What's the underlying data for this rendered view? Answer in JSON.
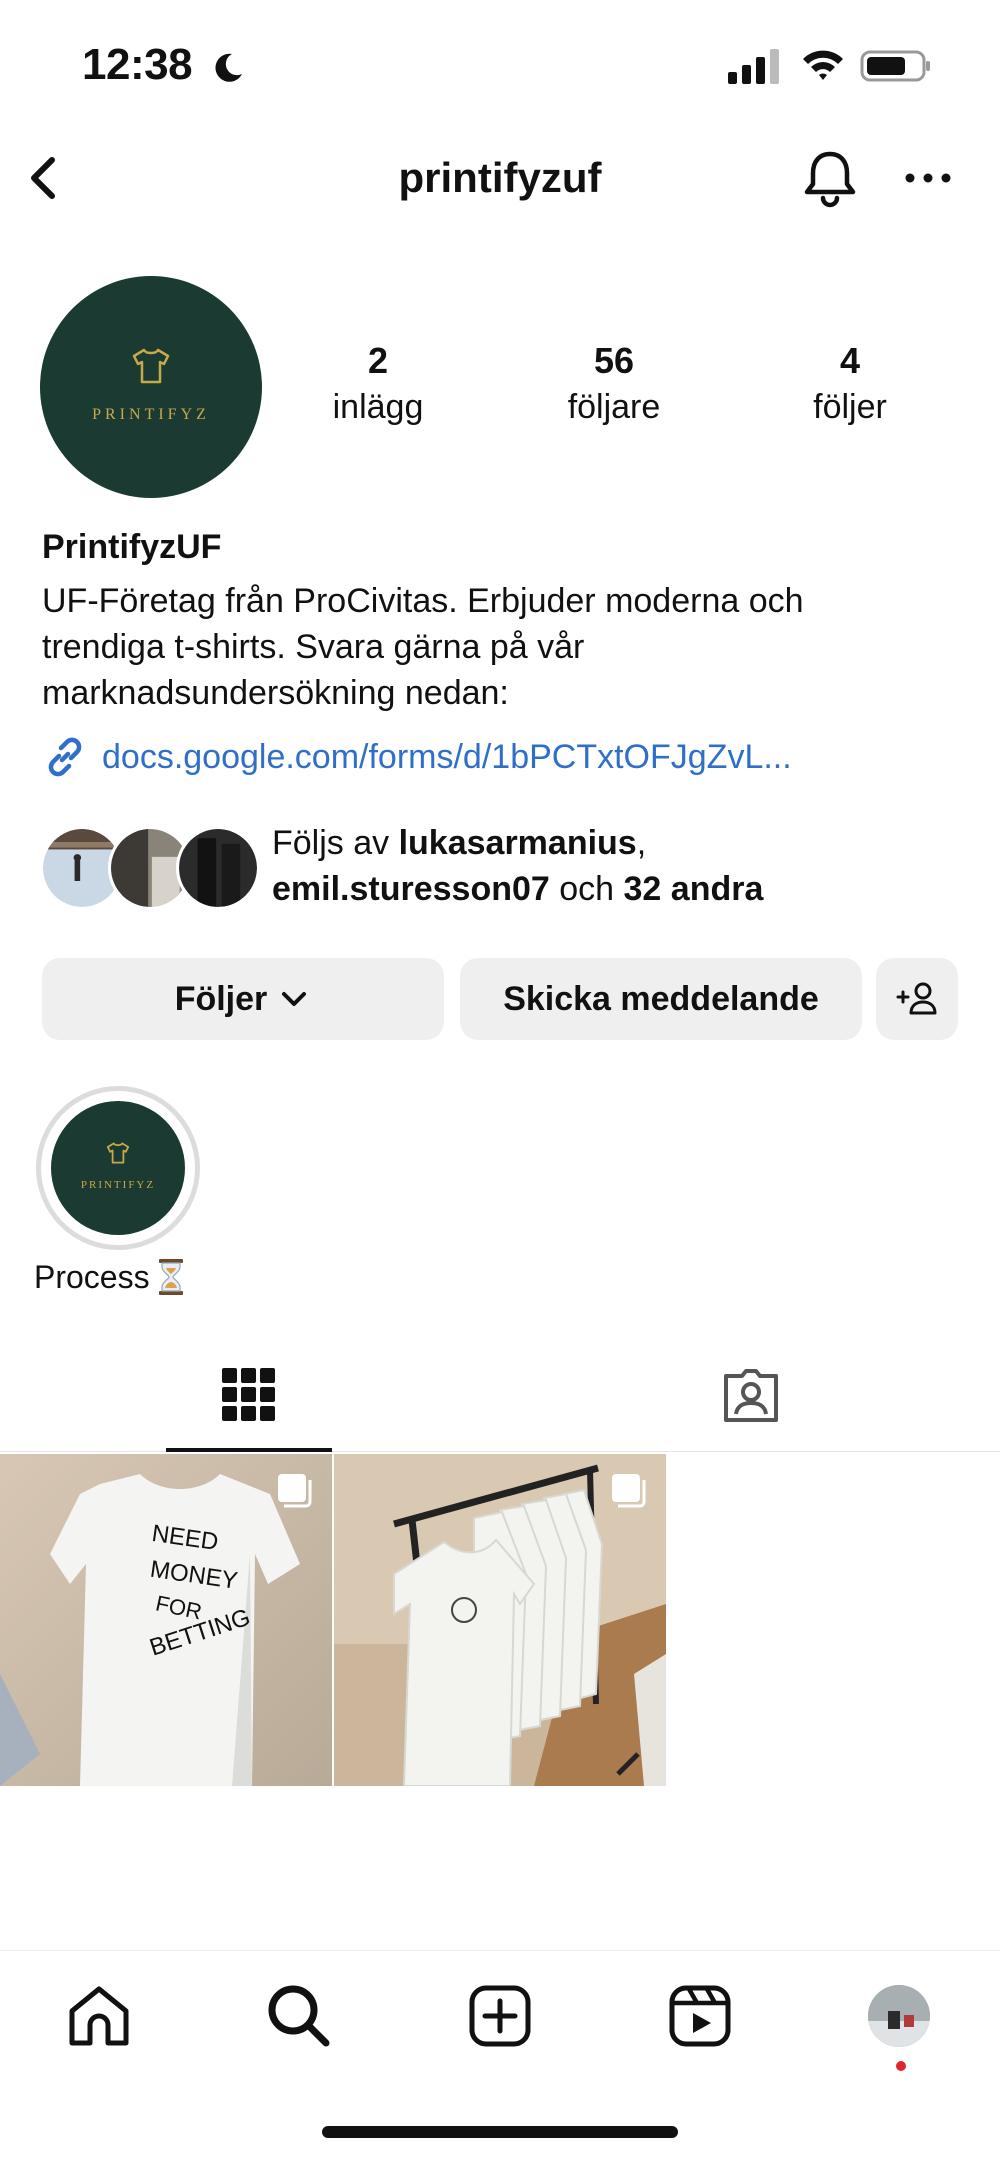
{
  "status_bar": {
    "time": "12:38"
  },
  "header": {
    "title": "printifyzuf"
  },
  "profile": {
    "avatar_brand": "PRINTIFYZ",
    "stats": [
      {
        "value": "2",
        "label": "inlägg"
      },
      {
        "value": "56",
        "label": "följare"
      },
      {
        "value": "4",
        "label": "följer"
      }
    ],
    "name": "PrintifyzUF",
    "bio_lines": [
      "UF-Företag från ProCivitas. Erbjuder moderna och",
      "trendiga t-shirts. Svara gärna på vår",
      "marknadsundersökning nedan:"
    ],
    "link": "docs.google.com/forms/d/1bPCTxtOFJgZvL..."
  },
  "followed_by": {
    "prefix": "Följs av ",
    "user1": "lukasarmanius",
    "comma": ",",
    "user2": "emil.sturesson07",
    "conjunction": " och ",
    "others": "32 andra"
  },
  "buttons": {
    "follow_label": "Följer",
    "message_label": "Skicka meddelande"
  },
  "highlights": [
    {
      "label": "Process",
      "brand": "PRINTIFYZ",
      "emoji": "hourglass-icon"
    }
  ],
  "posts": [
    {
      "shirt_text_lines": [
        "NEED",
        "MONEY",
        "FOR",
        "BETTING"
      ],
      "multi": true
    },
    {
      "multi": true
    }
  ],
  "colors": {
    "brand_green": "#1b3a32",
    "brand_gold": "#c9a84a",
    "link_blue": "#2f6fc9",
    "button_bg": "#efefef",
    "notification_dot": "#e0252e"
  },
  "nav": {
    "items": [
      "home-icon",
      "search-icon",
      "new-post-icon",
      "reels-icon",
      "profile-avatar"
    ]
  }
}
